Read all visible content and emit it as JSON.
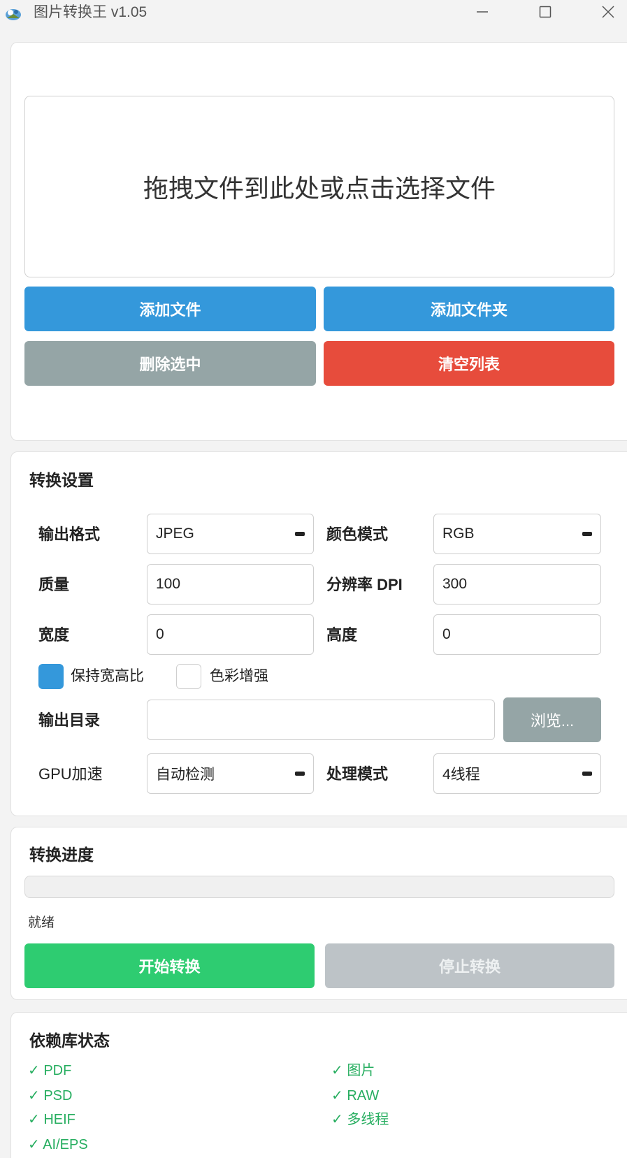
{
  "window": {
    "title": "图片转换王 v1.05",
    "minimize_glyph": "—",
    "maximize_glyph": "☐",
    "close_glyph": "✕"
  },
  "file_panel": {
    "dropzone_text": "拖拽文件到此处或点击选择文件",
    "add_file": "添加文件",
    "add_folder": "添加文件夹",
    "delete_selected": "删除选中",
    "clear_list": "清空列表"
  },
  "settings": {
    "title": "转换设置",
    "output_format_label": "输出格式",
    "output_format_value": "JPEG",
    "color_mode_label": "颜色模式",
    "color_mode_value": "RGB",
    "quality_label": "质量",
    "quality_value": "100",
    "dpi_label": "分辨率 DPI",
    "dpi_value": "300",
    "width_label": "宽度",
    "width_value": "0",
    "height_label": "高度",
    "height_value": "0",
    "keep_ratio_label": "保持宽高比",
    "keep_ratio_checked": true,
    "color_enhance_label": "色彩增强",
    "color_enhance_checked": false,
    "output_dir_label": "输出目录",
    "output_dir_value": "",
    "browse_label": "浏览...",
    "gpu_label": "GPU加速",
    "gpu_value": "自动检测",
    "mode_label": "处理模式",
    "mode_value": "4线程"
  },
  "progress": {
    "title": "转换进度",
    "percent": 0,
    "status": "就绪",
    "start_label": "开始转换",
    "stop_label": "停止转换"
  },
  "dependencies": {
    "title": "依赖库状态",
    "check_glyph": "✓",
    "items": [
      "PDF",
      "图片",
      "PSD",
      "RAW",
      "HEIF",
      "多线程",
      "AI/EPS"
    ],
    "color": "#27ae60"
  },
  "colors": {
    "blue": "#3498db",
    "gray": "#95a5a6",
    "red": "#e74c3c",
    "green": "#2ecc71",
    "disabled": "#bdc3c7"
  }
}
